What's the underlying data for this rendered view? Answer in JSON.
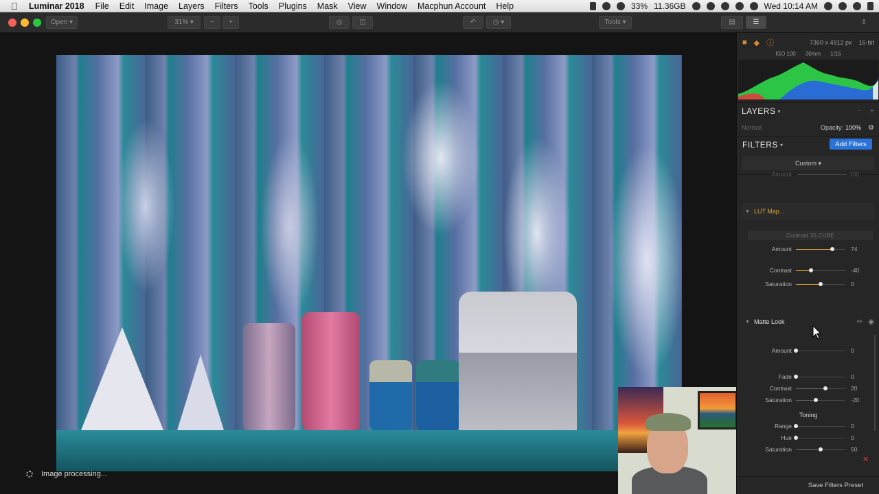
{
  "menubar": {
    "app": "Luminar 2018",
    "items": [
      "File",
      "Edit",
      "Image",
      "Layers",
      "Filters",
      "Tools",
      "Plugins",
      "Mask",
      "View",
      "Window",
      "Macphun Account",
      "Help"
    ],
    "battery": "33%",
    "memory": "11.36GB",
    "clock": "Wed 10:14 AM"
  },
  "toolbar": {
    "open_label": "Open",
    "zoom_value": "31%",
    "tools_label": "Tools"
  },
  "canvas": {
    "processing_text": "Image processing..."
  },
  "panel": {
    "image_size": "7360 x 4912 px",
    "bit_depth": "16-bit",
    "exif": [
      "ISO 100",
      "30mm",
      "1/16"
    ],
    "layers_title": "LAYERS",
    "blend_mode": "Normal",
    "opacity_label": "Opacity:",
    "opacity_value": "100%",
    "filters_title": "FILTERS",
    "add_filters": "Add Filters",
    "preset": "Custom",
    "prev_amount_label": "Amount",
    "prev_amount_value": "100",
    "lut": {
      "title": "LUT Map...",
      "file": "Contrast 35.CUBE",
      "sliders": [
        {
          "label": "Amount",
          "value": "74",
          "pos": 0.74
        },
        {
          "label": "Contrast",
          "value": "-40",
          "pos": 0.3
        },
        {
          "label": "Saturation",
          "value": "0",
          "pos": 0.5
        }
      ]
    },
    "matte": {
      "title": "Matte Look",
      "sliders": [
        {
          "label": "Amount",
          "value": "0",
          "pos": 0.0
        },
        {
          "label": "Fade",
          "value": "0",
          "pos": 0.0
        },
        {
          "label": "Contrast",
          "value": "20",
          "pos": 0.6
        },
        {
          "label": "Saturation",
          "value": "-20",
          "pos": 0.4
        }
      ],
      "toning_title": "Toning",
      "toning": [
        {
          "label": "Range",
          "value": "0",
          "pos": 0.0
        },
        {
          "label": "Hue",
          "value": "0",
          "pos": 0.0
        },
        {
          "label": "Saturation",
          "value": "50",
          "pos": 0.5
        }
      ]
    },
    "save_preset": "Save Filters Preset"
  },
  "colors": {
    "accent": "#2a73d9",
    "lut_title": "#d9a23a",
    "close_red": "#e03c3c"
  }
}
